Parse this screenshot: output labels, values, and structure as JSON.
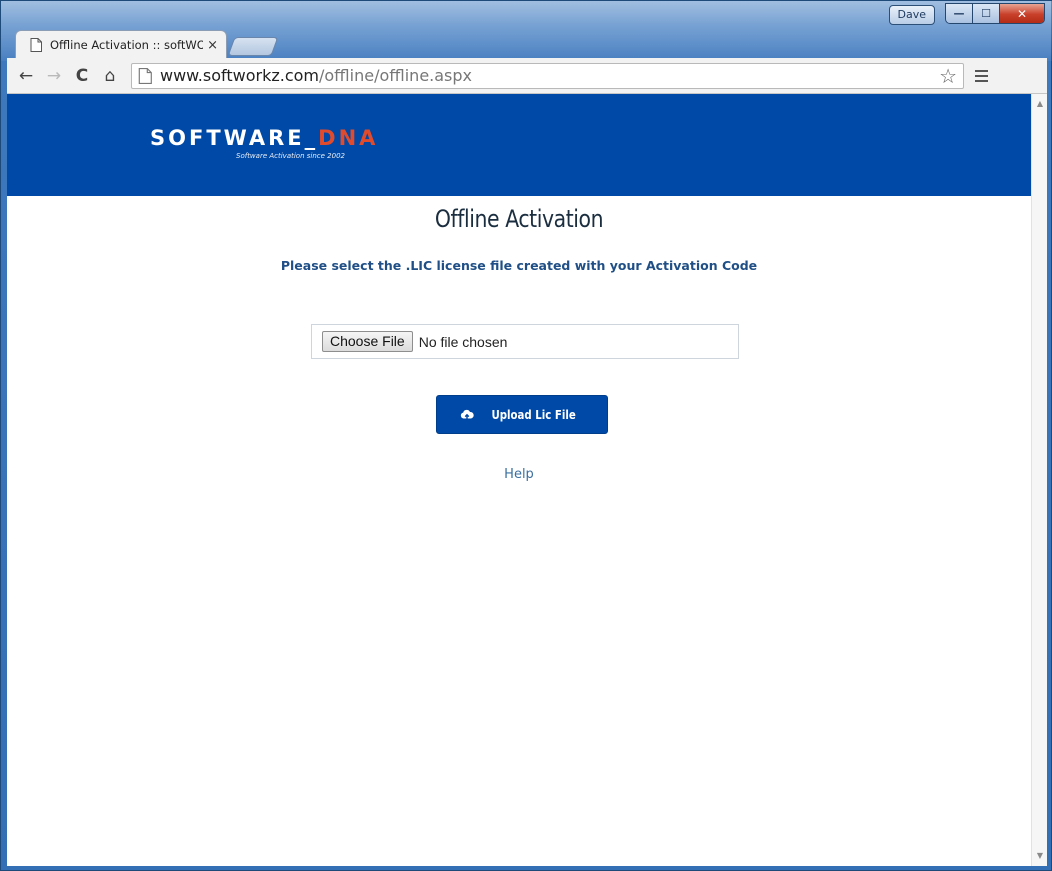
{
  "window": {
    "user_badge": "Dave",
    "minimize_glyph": "—",
    "maximize_glyph": "☐",
    "close_glyph": "✕"
  },
  "tab": {
    "title": "Offline Activation :: softWO",
    "close_glyph": "×",
    "icon": "page-icon"
  },
  "toolbar": {
    "back_glyph": "←",
    "forward_glyph": "→",
    "reload_glyph": "C",
    "home_glyph": "⌂",
    "url_host": "www.softworkz.com",
    "url_path": "/offline/offline.aspx",
    "star_glyph": "☆"
  },
  "site": {
    "logo_text_main": "SOFTWARE_",
    "logo_text_accent": "DNA",
    "logo_tagline": "Software Activation since 2002",
    "brand_color": "#0049a6",
    "accent_color": "#e04b2d"
  },
  "page": {
    "title": "Offline Activation",
    "instruction": "Please select the .LIC license file created with your Activation Code",
    "file_input": {
      "button_label": "Choose File",
      "status": "No file chosen"
    },
    "upload_button_label": "Upload Lic File",
    "upload_icon": "cloud-upload-icon",
    "help_link": "Help"
  }
}
